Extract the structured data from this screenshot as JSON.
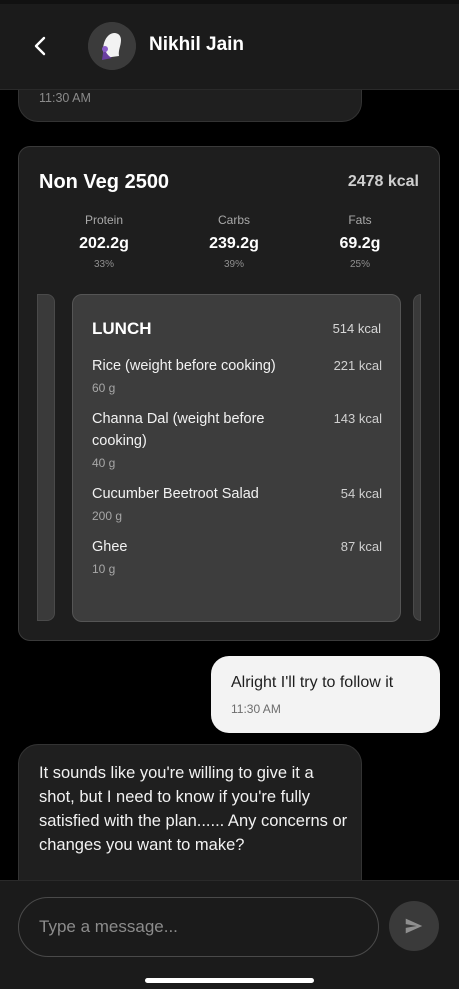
{
  "header": {
    "contact_name": "Nikhil Jain"
  },
  "messages": {
    "previous_time": "11:30 AM",
    "plan": {
      "title": "Non Veg 2500",
      "total_kcal": "2478 kcal",
      "macros": [
        {
          "label": "Protein",
          "value": "202.2g",
          "percent": "33%"
        },
        {
          "label": "Carbs",
          "value": "239.2g",
          "percent": "39%"
        },
        {
          "label": "Fats",
          "value": "69.2g",
          "percent": "25%"
        }
      ],
      "meal": {
        "title": "LUNCH",
        "kcal": "514 kcal",
        "items": [
          {
            "name": "Rice (weight before cooking)",
            "kcal": "221 kcal",
            "qty": "60 g"
          },
          {
            "name": "Channa Dal (weight before cooking)",
            "kcal": "143 kcal",
            "qty": "40 g"
          },
          {
            "name": "Cucumber Beetroot Salad",
            "kcal": "54 kcal",
            "qty": "200 g"
          },
          {
            "name": "Ghee",
            "kcal": "87 kcal",
            "qty": "10 g"
          }
        ]
      }
    },
    "outgoing": {
      "text": "Alright I'll try to follow it",
      "time": "11:30 AM"
    },
    "incoming": {
      "text": "It sounds like you're willing to give it a shot, but I need to know if you're fully satisfied with the plan...... Any concerns or changes you want to make?"
    }
  },
  "composer": {
    "placeholder": "Type a message..."
  },
  "icons": {
    "back": "chevron-left-icon",
    "send": "send-icon",
    "avatar": "user-silhouette-icon"
  }
}
